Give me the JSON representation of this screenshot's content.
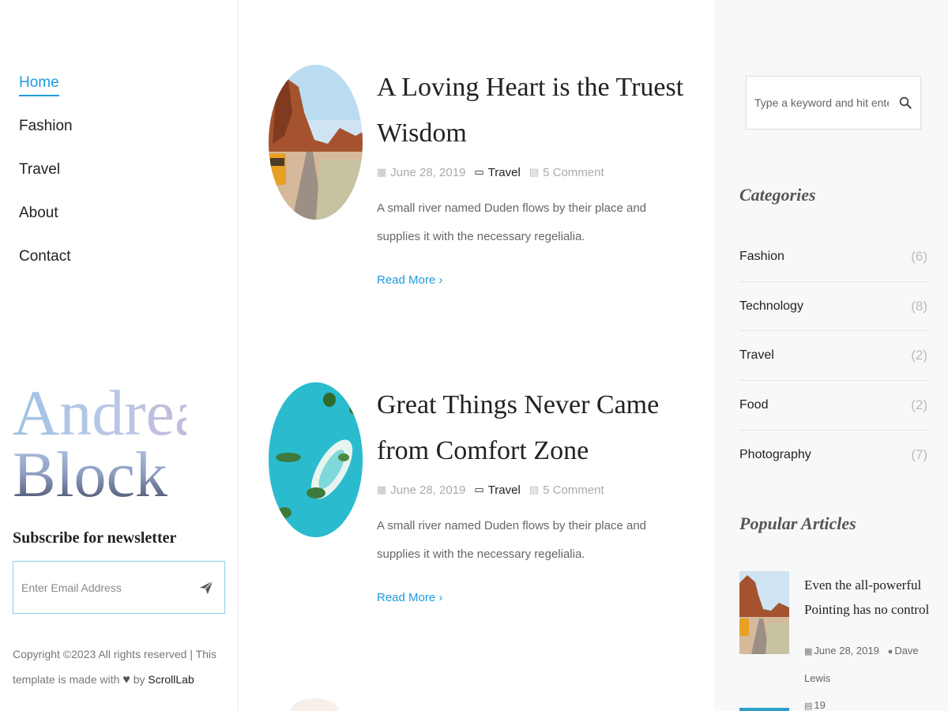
{
  "nav": {
    "items": [
      {
        "label": "Home",
        "active": true
      },
      {
        "label": "Fashion"
      },
      {
        "label": "Travel"
      },
      {
        "label": "About"
      },
      {
        "label": "Contact"
      }
    ]
  },
  "brand": {
    "line1": "Andrea",
    "line2": "Block"
  },
  "subscribe": {
    "title": "Subscribe for newsletter",
    "placeholder": "Enter Email Address",
    "icon": "paper-plane-icon"
  },
  "footer": {
    "text_before": "Copyright ©2023 All rights reserved | This template is made with",
    "heart": "♥",
    "by": "by",
    "author": "ScrollLab"
  },
  "posts": [
    {
      "title": "A Loving Heart is the Truest Wisdom",
      "date": "June 28, 2019",
      "category": "Travel",
      "comments": "5 Comment",
      "excerpt": "A small river named Duden flows by their place and supplies it with the necessary regelialia.",
      "read_more": "Read More",
      "image": "desert-road-van"
    },
    {
      "title": "Great Things Never Came from Comfort Zone",
      "date": "June 28, 2019",
      "category": "Travel",
      "comments": "5 Comment",
      "excerpt": "A small river named Duden flows by their place and supplies it with the necessary regelialia.",
      "read_more": "Read More",
      "image": "turquoise-islands-aerial"
    }
  ],
  "search": {
    "placeholder": "Type a keyword and hit enter",
    "icon": "search-icon"
  },
  "categories": {
    "heading": "Categories",
    "items": [
      {
        "name": "Fashion",
        "count": "(6)"
      },
      {
        "name": "Technology",
        "count": "(8)"
      },
      {
        "name": "Travel",
        "count": "(2)"
      },
      {
        "name": "Food",
        "count": "(2)"
      },
      {
        "name": "Photography",
        "count": "(7)"
      }
    ]
  },
  "popular": {
    "heading": "Popular Articles",
    "items": [
      {
        "title": "Even the all-powerful Pointing has no control",
        "date": "June 28, 2019",
        "author": "Dave Lewis",
        "comments": "19"
      }
    ]
  },
  "colors": {
    "accent": "#1d9ce0",
    "sidebar_bg": "#f7f8f9"
  }
}
